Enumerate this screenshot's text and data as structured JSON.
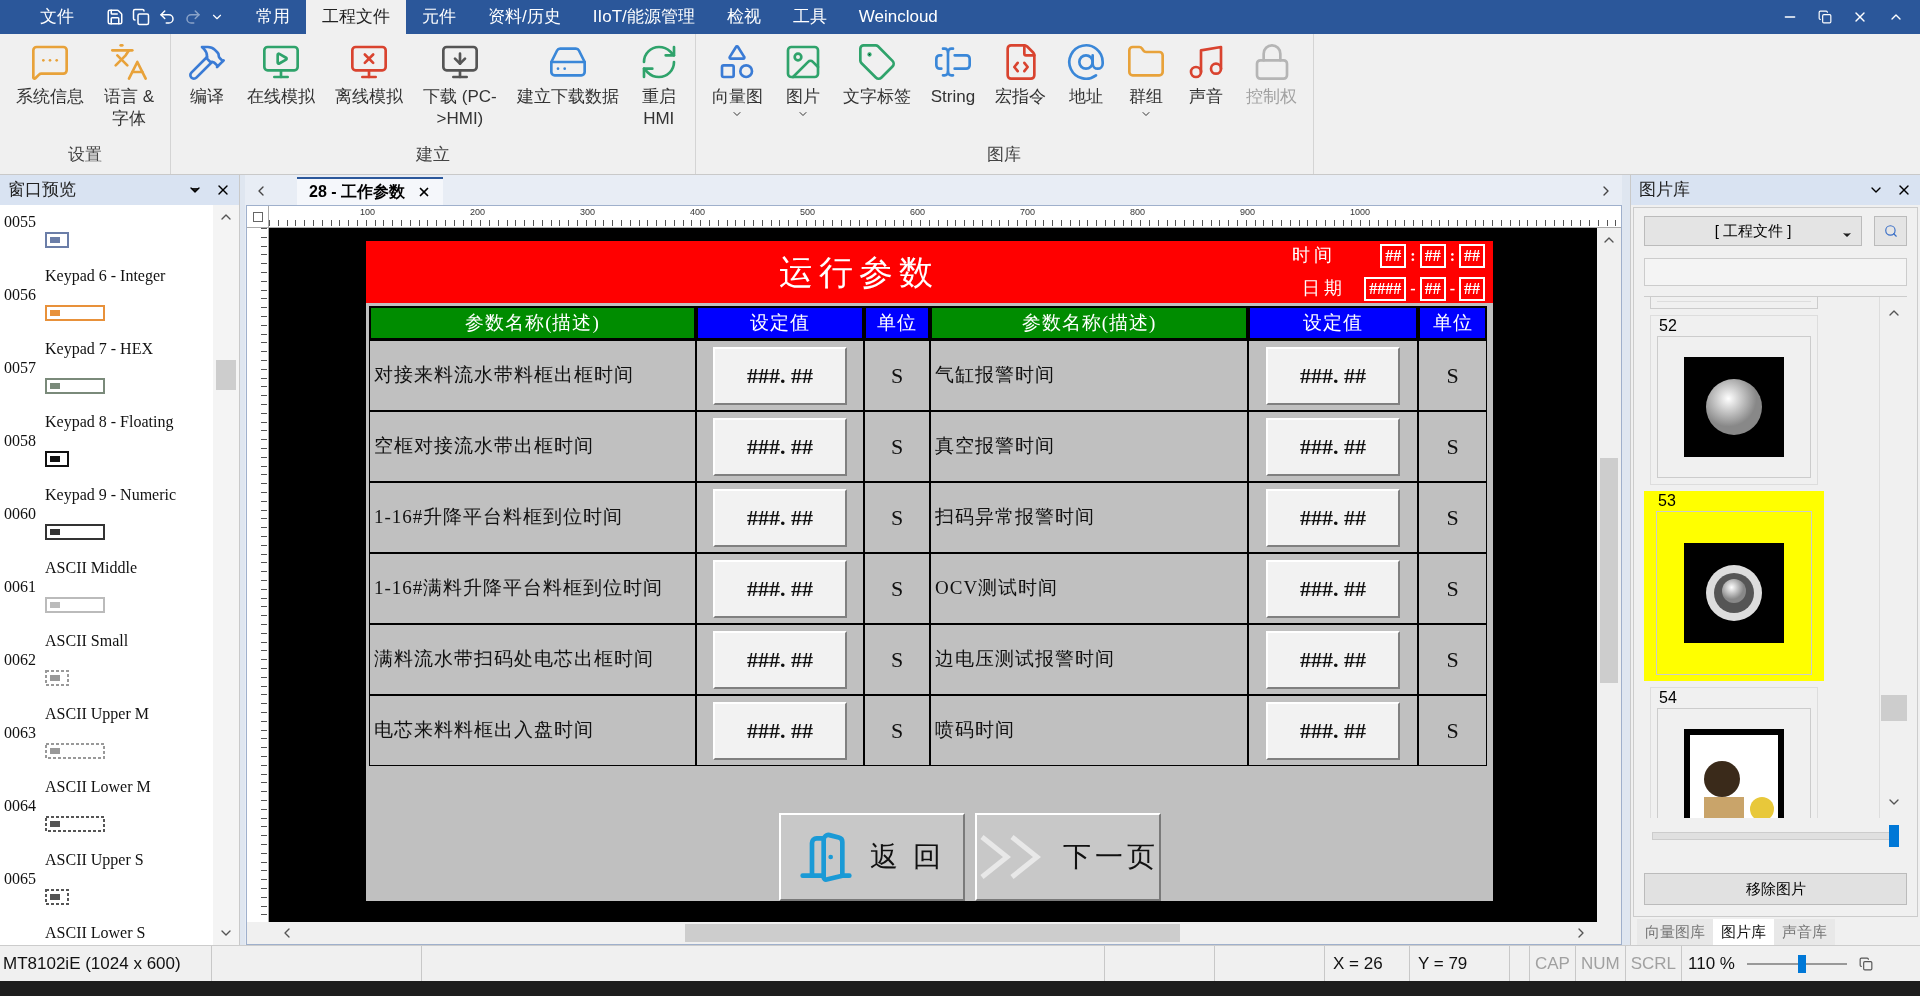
{
  "menu": {
    "items": [
      {
        "label": "文件",
        "selected": false
      },
      {
        "label": "常用",
        "selected": false
      },
      {
        "label": "工程文件",
        "selected": true
      },
      {
        "label": "元件",
        "selected": false
      },
      {
        "label": "资料/历史",
        "selected": false
      },
      {
        "label": "IIoT/能源管理",
        "selected": false
      },
      {
        "label": "检视",
        "selected": false
      },
      {
        "label": "工具",
        "selected": false
      },
      {
        "label": "Weincloud",
        "selected": false
      }
    ]
  },
  "ribbon": {
    "groups": [
      {
        "label": "设置",
        "items": [
          {
            "label": "系统信息",
            "dropdown": false,
            "disabled": false
          },
          {
            "label": "语言 &\n字体",
            "dropdown": false,
            "disabled": false
          }
        ]
      },
      {
        "label": "建立",
        "items": [
          {
            "label": "编译",
            "dropdown": false,
            "disabled": false
          },
          {
            "label": "在线模拟",
            "dropdown": false,
            "disabled": false
          },
          {
            "label": "离线模拟",
            "dropdown": false,
            "disabled": false
          },
          {
            "label": "下载 (PC-\n>HMI)",
            "dropdown": false,
            "disabled": false
          },
          {
            "label": "建立下载数据",
            "dropdown": false,
            "disabled": false
          },
          {
            "label": "重启\nHMI",
            "dropdown": false,
            "disabled": false
          }
        ]
      },
      {
        "label": "图库",
        "items": [
          {
            "label": "向量图",
            "dropdown": true,
            "disabled": false
          },
          {
            "label": "图片",
            "dropdown": true,
            "disabled": false
          },
          {
            "label": "文字标签",
            "dropdown": false,
            "disabled": false
          },
          {
            "label": "String",
            "dropdown": false,
            "disabled": false
          },
          {
            "label": "宏指令",
            "dropdown": false,
            "disabled": false
          },
          {
            "label": "地址",
            "dropdown": false,
            "disabled": false
          },
          {
            "label": "群组",
            "dropdown": true,
            "disabled": false
          },
          {
            "label": "声音",
            "dropdown": false,
            "disabled": false
          },
          {
            "label": "控制权",
            "dropdown": false,
            "disabled": true
          }
        ]
      }
    ]
  },
  "window_preview": {
    "title": "窗口预览",
    "items": [
      {
        "number": "0055"
      },
      {
        "name": "Keypad 6 - Integer",
        "number": "0056"
      },
      {
        "name": "Keypad 7 - HEX",
        "number": "0057"
      },
      {
        "name": "Keypad 8 - Floating",
        "number": "0058"
      },
      {
        "name": "Keypad 9 - Numeric",
        "number": "0060"
      },
      {
        "name": "ASCII Middle",
        "number": "0061"
      },
      {
        "name": "ASCII Small",
        "number": "0062"
      },
      {
        "name": "ASCII Upper M",
        "number": "0063"
      },
      {
        "name": "ASCII Lower M",
        "number": "0064"
      },
      {
        "name": "ASCII Upper S",
        "number": "0065"
      },
      {
        "name": "ASCII Lower S"
      }
    ]
  },
  "editor": {
    "tab": {
      "label": "28 - 工作参数",
      "selected": true
    },
    "ruler": [
      "100",
      "200",
      "300",
      "400",
      "500",
      "600",
      "700",
      "800",
      "900",
      "1000"
    ],
    "screen": {
      "title": "运行参数",
      "time_label": "时间",
      "date_label": "日期",
      "time_fields": [
        "##",
        "##",
        "##"
      ],
      "time_separators": [
        ":",
        ":"
      ],
      "date_fields": [
        "####",
        "##",
        "##"
      ],
      "date_separators": [
        "-",
        "-"
      ],
      "columns": [
        {
          "label": "参数名称(描述)",
          "kind": "name"
        },
        {
          "label": "设定值",
          "kind": "value"
        },
        {
          "label": "单位",
          "kind": "unit"
        },
        {
          "label": "参数名称(描述)",
          "kind": "name"
        },
        {
          "label": "设定值",
          "kind": "value"
        },
        {
          "label": "单位",
          "kind": "unit"
        }
      ],
      "rows": [
        {
          "left": {
            "name": "对接来料流水带料框出框时间",
            "value": "###. ##",
            "unit": "S"
          },
          "right": {
            "name": "气缸报警时间",
            "value": "###. ##",
            "unit": "S"
          }
        },
        {
          "left": {
            "name": "空框对接流水带出框时间",
            "value": "###. ##",
            "unit": "S"
          },
          "right": {
            "name": "真空报警时间",
            "value": "###. ##",
            "unit": "S"
          }
        },
        {
          "left": {
            "name": "1-16#升降平台料框到位时间",
            "value": "###. ##",
            "unit": "S"
          },
          "right": {
            "name": "扫码异常报警时间",
            "value": "###. ##",
            "unit": "S"
          }
        },
        {
          "left": {
            "name": "1-16#满料升降平台料框到位时间",
            "value": "###. ##",
            "unit": "S"
          },
          "right": {
            "name": "OCV测试时间",
            "value": "###. ##",
            "unit": "S"
          }
        },
        {
          "left": {
            "name": "满料流水带扫码处电芯出框时间",
            "value": "###. ##",
            "unit": "S"
          },
          "right": {
            "name": "边电压测试报警时间",
            "value": "###. ##",
            "unit": "S"
          }
        },
        {
          "left": {
            "name": "电芯来料料框出入盘时间",
            "value": "###. ##",
            "unit": "S"
          },
          "right": {
            "name": "喷码时间",
            "value": "###. ##",
            "unit": "S"
          }
        }
      ],
      "buttons": [
        {
          "label": "返 回",
          "kind": "back"
        },
        {
          "label": "下一页",
          "kind": "next"
        }
      ]
    }
  },
  "picture_library": {
    "title": "图片库",
    "source": "[ 工程文件 ]",
    "items": [
      {
        "number": "52",
        "kind": "sphere",
        "selected": false
      },
      {
        "number": "53",
        "kind": "ring",
        "selected": true
      },
      {
        "number": "54",
        "kind": "figure",
        "selected": false
      }
    ],
    "size_slider": {
      "level": 1
    },
    "remove_button": "移除图片",
    "tabs": [
      {
        "label": "向量图库",
        "selected": false
      },
      {
        "label": "图片库",
        "selected": true
      },
      {
        "label": "声音库",
        "selected": false
      }
    ]
  },
  "status_bar": {
    "model": "MT8102iE (1024 x 600)",
    "x": "X = 26",
    "y": "Y = 79",
    "indicators": [
      {
        "label": "CAP",
        "on": false
      },
      {
        "label": "NUM",
        "on": false
      },
      {
        "label": "SCRL",
        "on": false
      }
    ],
    "zoom": {
      "reading": "110 %",
      "level": 0.55
    }
  }
}
